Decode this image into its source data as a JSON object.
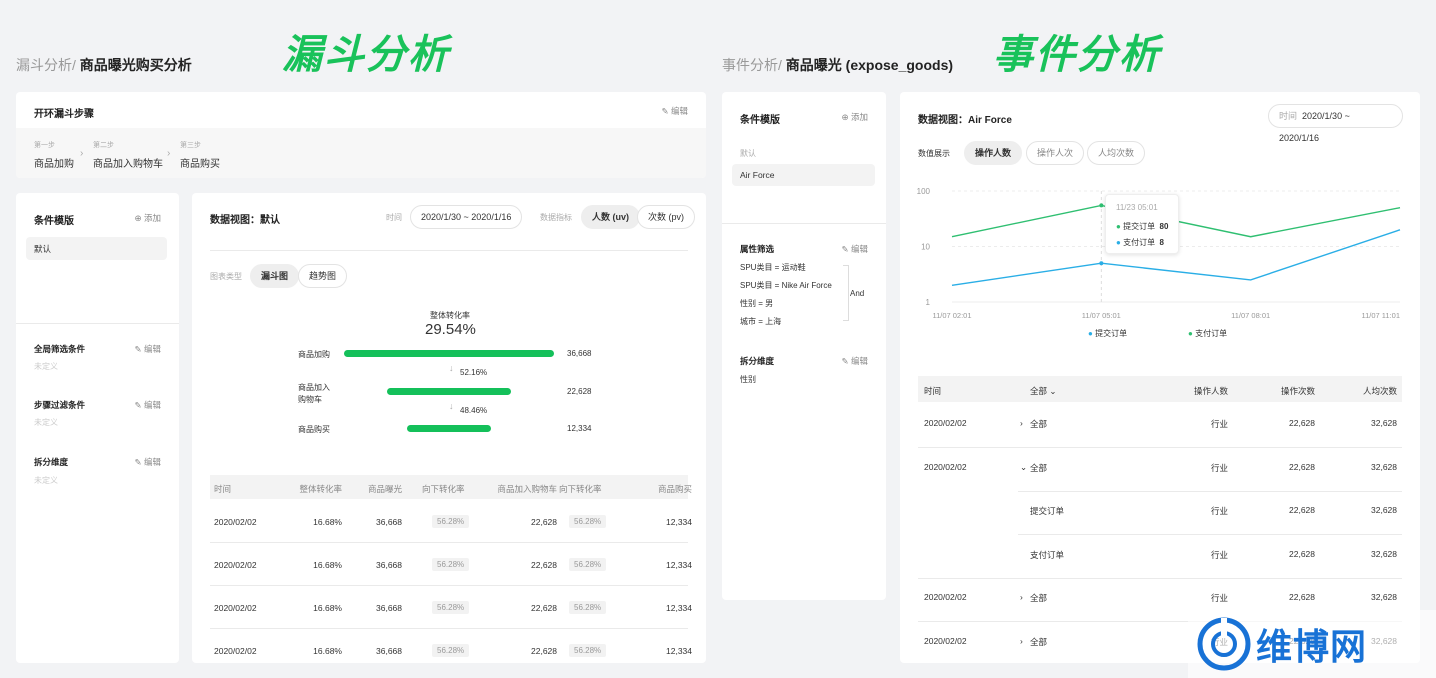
{
  "headers": {
    "left": "漏斗分析",
    "right": "事件分析"
  },
  "left": {
    "breadcrumb": {
      "parent": "漏斗分析/",
      "current": "商品曝光购买分析"
    },
    "steps_card": {
      "title": "开环漏斗步骤",
      "edit": "编辑",
      "steps": [
        {
          "num": "第一步",
          "name": "商品加购"
        },
        {
          "num": "第二步",
          "name": "商品加入购物车"
        },
        {
          "num": "第三步",
          "name": "商品购买"
        }
      ]
    },
    "sidebar": {
      "template_title": "条件模版",
      "add": "添加",
      "default": "默认",
      "sections": [
        {
          "title": "全局筛选条件",
          "edit": "编辑",
          "value": "未定义"
        },
        {
          "title": "步骤过滤条件",
          "edit": "编辑",
          "value": "未定义"
        },
        {
          "title": "拆分维度",
          "edit": "编辑",
          "value": "未定义"
        }
      ]
    },
    "main": {
      "title": "数据视图：默认",
      "time_label": "时间",
      "time_value": "2020/1/30 ~ 2020/1/16",
      "metric_label": "数据指标",
      "metric_active": "人数 (uv)",
      "metric_other": "次数 (pv)",
      "chart_type_label": "图表类型",
      "chart_type_active": "漏斗图",
      "chart_type_other": "趋势图",
      "overall_label": "整体转化率",
      "overall_value": "29.54%",
      "funnel": [
        {
          "label1": "商品加购",
          "label2": "",
          "value": "36,668",
          "fill": 1.0
        },
        {
          "label1": "商品加入",
          "label2": "购物车",
          "value": "22,628",
          "fill": 0.59
        },
        {
          "label1": "商品购买",
          "label2": "",
          "value": "12,334",
          "fill": 0.4
        }
      ],
      "conversions": [
        "52.16%",
        "48.46%"
      ],
      "table": {
        "headers": [
          "时间",
          "整体转化率",
          "商品曝光",
          "向下转化率",
          "商品加入购物车",
          "向下转化率",
          "商品购买"
        ],
        "rows": [
          [
            "2020/02/02",
            "16.68%",
            "36,668",
            "56.28%",
            "22,628",
            "56.28%",
            "12,334"
          ],
          [
            "2020/02/02",
            "16.68%",
            "36,668",
            "56.28%",
            "22,628",
            "56.28%",
            "12,334"
          ],
          [
            "2020/02/02",
            "16.68%",
            "36,668",
            "56.28%",
            "22,628",
            "56.28%",
            "12,334"
          ],
          [
            "2020/02/02",
            "16.68%",
            "36,668",
            "56.28%",
            "22,628",
            "56.28%",
            "12,334"
          ]
        ]
      }
    }
  },
  "right": {
    "breadcrumb": {
      "parent": "事件分析/",
      "current": "商品曝光 (expose_goods)"
    },
    "sidebar": {
      "template_title": "条件模版",
      "add": "添加",
      "default_label": "默认",
      "selected": "Air Force",
      "attr_title": "属性筛选",
      "edit": "编辑",
      "attrs": [
        "SPU类目 = 运动鞋",
        "SPU类目 = Nike Air Force",
        "性别 = 男",
        "城市 = 上海"
      ],
      "and": "And",
      "split_title": "拆分维度",
      "split_value": "性别"
    },
    "main": {
      "title": "数据视图：Air Force",
      "time_label": "时间",
      "time_value": "2020/1/30 ~ 2020/1/16",
      "value_label": "数值展示",
      "tabs": [
        "操作人数",
        "操作人次",
        "人均次数"
      ],
      "tooltip": {
        "time": "11/23 05:01",
        "items": [
          {
            "name": "提交订单",
            "value": "80"
          },
          {
            "name": "支付订单",
            "value": "8"
          }
        ]
      },
      "legend": [
        "提交订单",
        "支付订单"
      ],
      "table": {
        "headers": [
          "时间",
          "全部",
          "操作人数",
          "操作次数",
          "人均次数"
        ],
        "rows": [
          {
            "time": "2020/02/02",
            "arrow": "›",
            "group": "全部",
            "a": "行业",
            "b": "22,628",
            "c": "32,628"
          },
          {
            "time": "2020/02/02",
            "arrow": "⌄",
            "group": "全部",
            "a": "行业",
            "b": "22,628",
            "c": "32,628"
          },
          {
            "time": "",
            "arrow": "",
            "group": "提交订单",
            "a": "行业",
            "b": "22,628",
            "c": "32,628"
          },
          {
            "time": "",
            "arrow": "",
            "group": "支付订单",
            "a": "行业",
            "b": "22,628",
            "c": "32,628"
          },
          {
            "time": "2020/02/02",
            "arrow": "›",
            "group": "全部",
            "a": "行业",
            "b": "22,628",
            "c": "32,628"
          },
          {
            "time": "2020/02/02",
            "arrow": "›",
            "group": "全部",
            "a": "行业",
            "b": "22,628",
            "c": "32,628"
          }
        ]
      }
    }
  },
  "chart_data": {
    "type": "line",
    "x": [
      "11/07 02:01",
      "11/07 05:01",
      "11/07 08:01",
      "11/07 11:01"
    ],
    "y_ticks": [
      "100",
      "10",
      "1"
    ],
    "y_scale": "log",
    "ylim": [
      1,
      100
    ],
    "series": [
      {
        "name": "提交订单",
        "color": "#2aaee6",
        "values": [
          2,
          5,
          2.5,
          20
        ]
      },
      {
        "name": "支付订单",
        "color": "#2fbf71",
        "values": [
          15,
          55,
          15,
          50
        ]
      }
    ],
    "legend_position": "bottom"
  },
  "watermark": "维博网",
  "colors": {
    "accent": "#14c05a",
    "blue": "#2aaee6",
    "green": "#2fbf71"
  }
}
